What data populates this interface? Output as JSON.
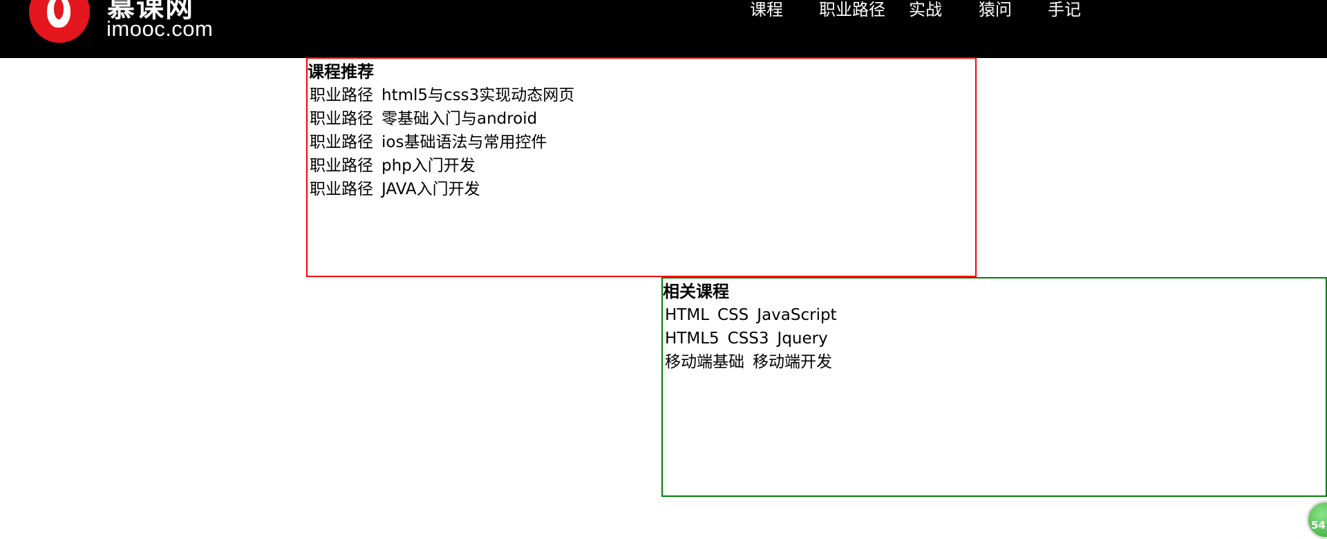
{
  "header": {
    "logo_cn": "慕课网",
    "logo_en": "imooc.com",
    "nav": [
      "课程",
      "职业路径",
      "实战",
      "猿问",
      "手记"
    ]
  },
  "recommend": {
    "title": "课程推荐",
    "rows": [
      {
        "tag": "职业路径",
        "name": "html5与css3实现动态网页"
      },
      {
        "tag": "职业路径",
        "name": "零基础入门与android"
      },
      {
        "tag": "职业路径",
        "name": "ios基础语法与常用控件"
      },
      {
        "tag": "职业路径",
        "name": "php入门开发"
      },
      {
        "tag": "职业路径",
        "name": "JAVA入门开发"
      }
    ]
  },
  "related": {
    "title": "相关课程",
    "rows": [
      [
        "HTML",
        "CSS",
        "JavaScript"
      ],
      [
        "HTML5",
        "CSS3",
        "Jquery"
      ],
      [
        "移动端基础",
        "移动端开发"
      ]
    ]
  },
  "badge": {
    "value": "54"
  },
  "colors": {
    "recommend_border": "#ff0000",
    "related_border": "#008000",
    "logo_red": "#e3171d"
  }
}
